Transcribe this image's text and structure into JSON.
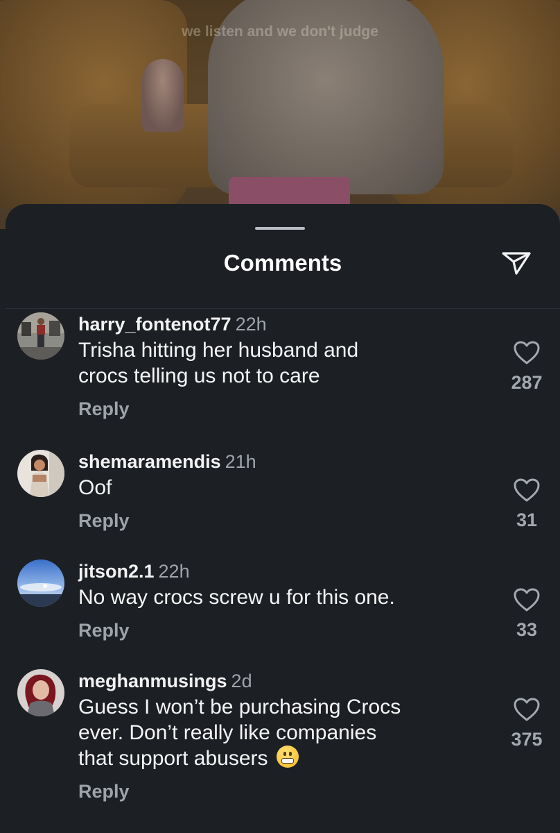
{
  "video": {
    "caption": "we listen and we don't judge"
  },
  "sheet": {
    "title": "Comments",
    "share_icon": "send-icon"
  },
  "comments": [
    {
      "username": "harry_fontenot77",
      "time": "22h",
      "text_lines": [
        "Trisha hitting her husband and",
        "crocs  telling us not to care"
      ],
      "reply_label": "Reply",
      "likes": "287"
    },
    {
      "username": "shemaramendis",
      "time": "21h",
      "text_lines": [
        "Oof"
      ],
      "reply_label": "Reply",
      "likes": "31"
    },
    {
      "username": "jitson2.1",
      "time": "22h",
      "text_lines": [
        "No way crocs screw u for this one."
      ],
      "reply_label": "Reply",
      "likes": "33"
    },
    {
      "username": "meghanmusings",
      "time": "2d",
      "text_lines": [
        "Guess I won’t be purchasing Crocs",
        "ever. Don’t really like companies",
        "that support abusers"
      ],
      "emoji": "grimacing-face",
      "reply_label": "Reply",
      "likes": "375"
    }
  ],
  "colors": {
    "background": "#1c1f24",
    "secondary_text": "#a0a4ab"
  }
}
